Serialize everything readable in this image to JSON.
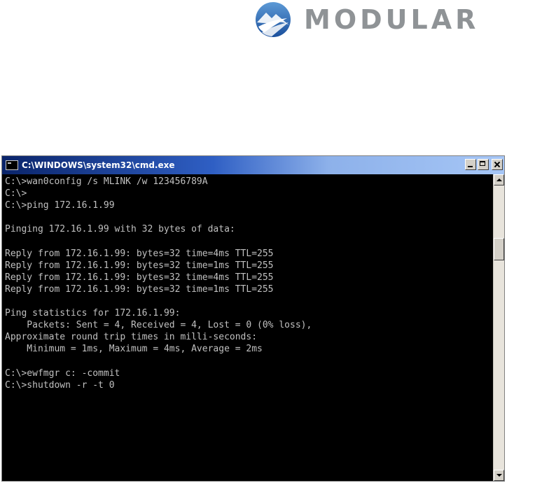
{
  "brand": {
    "name": "MODULAR",
    "mark_icon": "modular-mountain-swoosh-logo",
    "colors": {
      "mark_blue": "#1e5aa8",
      "mark_light": "#ffffff",
      "wordmark_gray": "#8f9396"
    }
  },
  "window": {
    "title": "C:\\WINDOWS\\system32\\cmd.exe",
    "title_icon": "console-window-icon",
    "buttons": {
      "minimize_icon": "minimize-icon",
      "maximize_icon": "maximize-icon",
      "close_icon": "close-icon"
    },
    "colors": {
      "titlebar_start": "#0a246a",
      "titlebar_end": "#a6c6f6",
      "console_bg": "#000000",
      "console_text": "#c0c0c0"
    }
  },
  "console": {
    "lines": [
      "C:\\>wan0config /s MLINK /w 123456789A",
      "C:\\>",
      "C:\\>ping 172.16.1.99",
      "",
      "Pinging 172.16.1.99 with 32 bytes of data:",
      "",
      "Reply from 172.16.1.99: bytes=32 time=4ms TTL=255",
      "Reply from 172.16.1.99: bytes=32 time=1ms TTL=255",
      "Reply from 172.16.1.99: bytes=32 time=4ms TTL=255",
      "Reply from 172.16.1.99: bytes=32 time=1ms TTL=255",
      "",
      "Ping statistics for 172.16.1.99:",
      "    Packets: Sent = 4, Received = 4, Lost = 0 (0% loss),",
      "Approximate round trip times in milli-seconds:",
      "    Minimum = 1ms, Maximum = 4ms, Average = 2ms",
      "",
      "C:\\>ewfmgr c: -commit",
      "C:\\>shutdown -r -t 0"
    ]
  },
  "scrollbar": {
    "up_icon": "scroll-up-arrow-icon",
    "down_icon": "scroll-down-arrow-icon",
    "thumb_position_fraction": 0.2
  }
}
